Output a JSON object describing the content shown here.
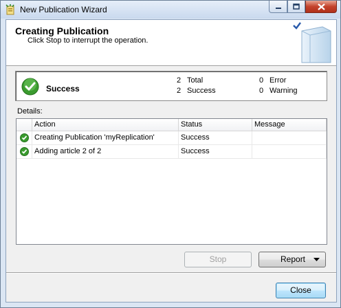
{
  "window": {
    "title": "New Publication Wizard"
  },
  "header": {
    "title": "Creating Publication",
    "subtitle": "Click Stop to interrupt the operation."
  },
  "summary": {
    "status": "Success",
    "total_count": "2",
    "total_label": "Total",
    "success_count": "2",
    "success_label": "Success",
    "error_count": "0",
    "error_label": "Error",
    "warning_count": "0",
    "warning_label": "Warning"
  },
  "details": {
    "label": "Details:",
    "columns": [
      "Action",
      "Status",
      "Message"
    ],
    "rows": [
      {
        "action": "Creating Publication 'myReplication'",
        "status": "Success",
        "message": ""
      },
      {
        "action": "Adding article 2 of 2",
        "status": "Success",
        "message": ""
      }
    ]
  },
  "buttons": {
    "stop": "Stop",
    "report": "Report",
    "close": "Close"
  },
  "colors": {
    "success_green": "#3a9b2e",
    "accent_blue": "#3c7fb1"
  }
}
